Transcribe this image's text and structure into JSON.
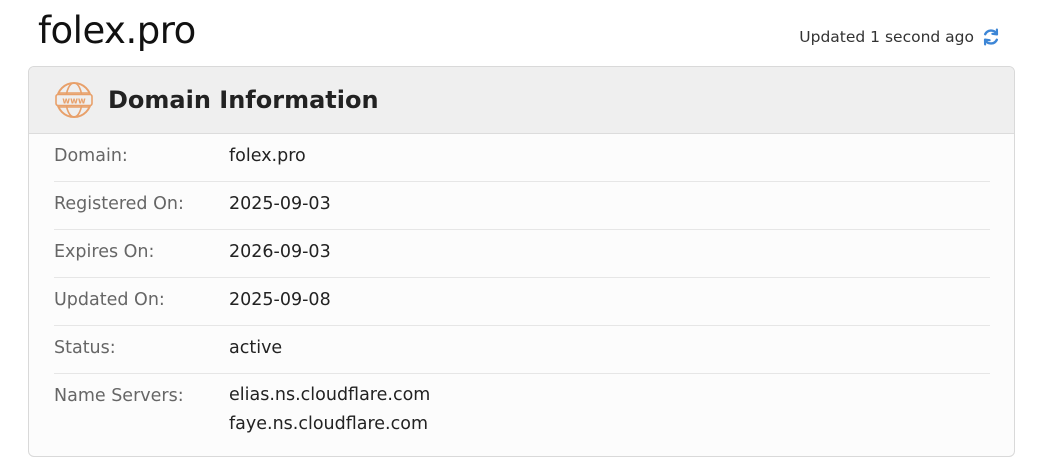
{
  "header": {
    "site_title": "folex.pro",
    "updated_text": "Updated 1 second ago",
    "refresh_icon": "refresh-icon",
    "refresh_color": "#3d86d6"
  },
  "card": {
    "icon": "www-globe-icon",
    "icon_color": "#e8a06a",
    "title": "Domain Information",
    "rows": [
      {
        "label": "Domain:",
        "value": "folex.pro"
      },
      {
        "label": "Registered On:",
        "value": "2025-09-03"
      },
      {
        "label": "Expires On:",
        "value": "2026-09-03"
      },
      {
        "label": "Updated On:",
        "value": "2025-09-08"
      },
      {
        "label": "Status:",
        "value": "active"
      }
    ],
    "name_servers": {
      "label": "Name Servers:",
      "values": [
        "elias.ns.cloudflare.com",
        "faye.ns.cloudflare.com"
      ]
    }
  }
}
